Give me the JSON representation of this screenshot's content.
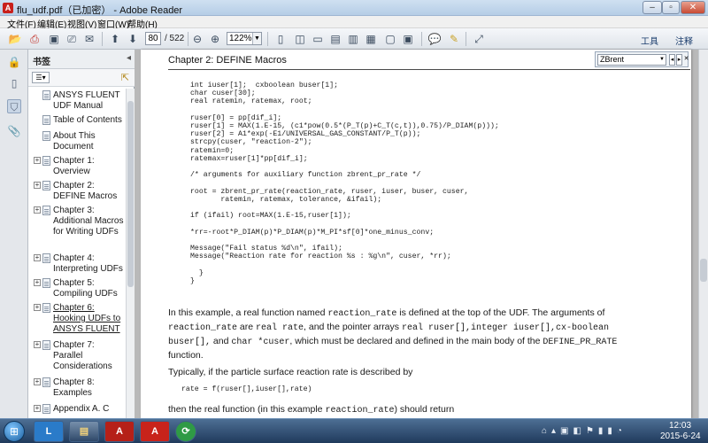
{
  "window": {
    "title": "flu_udf.pdf（已加密） - Adobe Reader",
    "app_icon": "adobe-reader-icon"
  },
  "menu": {
    "file": "文件(F)",
    "edit": "编辑(E)",
    "view": "视图(V)",
    "window": "窗口(W)",
    "help": "帮助(H)"
  },
  "toolbar": {
    "page_current": "80",
    "page_total": "/ 522",
    "zoom": "122%",
    "tools_label": "工具",
    "comment_label": "注释"
  },
  "find": {
    "query": "ZBrent"
  },
  "sidebar": {
    "title": "书签",
    "items": [
      {
        "label": "ANSYS FLUENT UDF Manual",
        "expandable": false
      },
      {
        "label": "Table of Contents",
        "expandable": false
      },
      {
        "label": "About This Document",
        "expandable": false
      },
      {
        "label": "Chapter 1: Overview",
        "expandable": true
      },
      {
        "label": "Chapter 2: DEFINE Macros",
        "expandable": true
      },
      {
        "label": "Chapter 3: Additional Macros for Writing UDFs",
        "expandable": true
      },
      {
        "label": "Chapter 4: Interpreting UDFs",
        "expandable": true
      },
      {
        "label": "Chapter 5: Compiling UDFs",
        "expandable": true
      },
      {
        "label": "Chapter 6: Hooking UDFs to ANSYS FLUENT",
        "expandable": true,
        "selected": true
      },
      {
        "label": "Chapter 7: Parallel Considerations",
        "expandable": true
      },
      {
        "label": "Chapter 8: Examples",
        "expandable": true
      },
      {
        "label": "Appendix A. C",
        "expandable": true
      }
    ]
  },
  "document": {
    "chapter_header": "Chapter 2: DEFINE Macros",
    "code_lines": [
      "int iuser[1];  cxboolean buser[1];",
      "char cuser[30];",
      "real ratemin, ratemax, root;",
      "",
      "ruser[0] = pp[dif_i];",
      "ruser[1] = MAX(1.E-15, (c1*pow(0.5*(P_T(p)+C_T(c,t)),0.75)/P_DIAM(p)));",
      "ruser[2] = A1*exp(-E1/UNIVERSAL_GAS_CONSTANT/P_T(p));",
      "strcpy(cuser, \"reaction-2\");",
      "ratemin=0;",
      "ratemax=ruser[1]*pp[dif_i];",
      "",
      "/* arguments for auxiliary function zbrent_pr_rate */",
      "",
      "root = zbrent_pr_rate(reaction_rate, ruser, iuser, buser, cuser,",
      "       ratemin, ratemax, tolerance, &ifail);",
      "",
      "if (ifail) root=MAX(1.E-15,ruser[1]);",
      "",
      "*rr=-root*P_DIAM(p)*P_DIAM(p)*M_PI*sf[0]*one_minus_conv;",
      "",
      "Message(\"Fail status %d\\n\", ifail);",
      "Message(\"Reaction rate for reaction %s : %g\\n\", cuser, *rr);",
      "",
      "  }",
      "}"
    ],
    "para1": [
      {
        "t": "In this example, a real function named "
      },
      {
        "t": "reaction_rate",
        "mono": true
      },
      {
        "t": " is defined at the top of the UDF. The arguments of "
      },
      {
        "t": "reaction_rate",
        "mono": true
      },
      {
        "t": " are "
      },
      {
        "t": "real rate",
        "mono": true
      },
      {
        "t": ", and the pointer arrays "
      },
      {
        "t": "real ruser[],integer iuser[],cx-boolean buser[],",
        "mono": true
      },
      {
        "t": " and "
      },
      {
        "t": "char *cuser",
        "mono": true
      },
      {
        "t": ", which must be declared and defined in the main body of the "
      },
      {
        "t": "DEFINE_PR_RATE",
        "mono": true
      },
      {
        "t": " function."
      }
    ],
    "para2": "Typically, if the particle surface reaction rate is described by",
    "code2": "rate = f(ruser[],iuser[],rate)",
    "para3": [
      {
        "t": "then the real function (in this example "
      },
      {
        "t": "reaction_rate",
        "mono": true
      },
      {
        "t": ") should return"
      }
    ]
  },
  "taskbar": {
    "start_icon": "windows-start-icon",
    "time": "12:03",
    "date": "2015-6-24",
    "apps": [
      "lync-icon",
      "file-explorer-icon",
      "adobe-reader-icon",
      "acrobat-icon",
      "refresh-app-icon"
    ]
  }
}
